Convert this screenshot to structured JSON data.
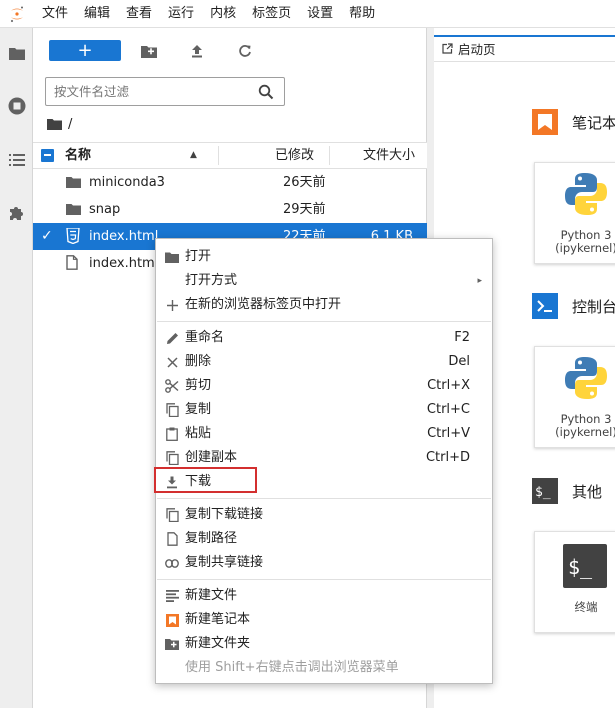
{
  "menubar": {
    "items": [
      "文件",
      "编辑",
      "查看",
      "运行",
      "内核",
      "标签页",
      "设置",
      "帮助"
    ]
  },
  "filebrowser": {
    "new_button": "+",
    "filter_placeholder": "按文件名过滤",
    "breadcrumb": "/",
    "columns": {
      "name": "名称",
      "modified": "已修改",
      "size": "文件大小"
    },
    "files": [
      {
        "name": "miniconda3",
        "modified": "26天前",
        "size": "",
        "icon": "folder-icon",
        "selected": false
      },
      {
        "name": "snap",
        "modified": "29天前",
        "size": "",
        "icon": "folder-icon",
        "selected": false
      },
      {
        "name": "index.html",
        "modified": "22天前",
        "size": "6.1 KB",
        "icon": "html5-icon",
        "selected": true
      },
      {
        "name": "index.html",
        "modified": "",
        "size": "",
        "icon": "file-icon",
        "selected": false
      }
    ]
  },
  "launcher": {
    "tab_label": "启动页",
    "sections": [
      {
        "title": "笔记本",
        "cards": [
          {
            "line1": "Python 3",
            "line2": "(ipykernel)"
          }
        ]
      },
      {
        "title": "控制台",
        "cards": [
          {
            "line1": "Python 3",
            "line2": "(ipykernel)"
          }
        ]
      },
      {
        "title": "其他",
        "cards": [
          {
            "line1": "终端",
            "line2": ""
          }
        ]
      }
    ]
  },
  "context_menu": {
    "items": [
      {
        "label": "打开",
        "shortcut": "",
        "icon": "folder-icon"
      },
      {
        "label": "打开方式",
        "shortcut": "",
        "icon": "",
        "submenu": true
      },
      {
        "label": "在新的浏览器标签页中打开",
        "shortcut": "",
        "icon": "plus-icon"
      },
      {
        "label": "重命名",
        "shortcut": "F2",
        "icon": "pencil-icon"
      },
      {
        "label": "删除",
        "shortcut": "Del",
        "icon": "close-icon"
      },
      {
        "label": "剪切",
        "shortcut": "Ctrl+X",
        "icon": "scissors-icon"
      },
      {
        "label": "复制",
        "shortcut": "Ctrl+C",
        "icon": "copy-icon"
      },
      {
        "label": "粘贴",
        "shortcut": "Ctrl+V",
        "icon": "paste-icon"
      },
      {
        "label": "创建副本",
        "shortcut": "Ctrl+D",
        "icon": "duplicate-icon"
      },
      {
        "label": "下载",
        "shortcut": "",
        "icon": "download-icon"
      },
      {
        "label": "复制下载链接",
        "shortcut": "",
        "icon": "copy-icon"
      },
      {
        "label": "复制路径",
        "shortcut": "",
        "icon": "file-icon"
      },
      {
        "label": "复制共享链接",
        "shortcut": "",
        "icon": "link-icon"
      },
      {
        "label": "新建文件",
        "shortcut": "",
        "icon": "text-file-icon"
      },
      {
        "label": "新建笔记本",
        "shortcut": "",
        "icon": "notebook-icon"
      },
      {
        "label": "新建文件夹",
        "shortcut": "",
        "icon": "new-folder-icon"
      },
      {
        "label": "使用 Shift+右键点击调出浏览器菜单",
        "shortcut": "",
        "icon": "",
        "disabled": true
      }
    ]
  },
  "colors": {
    "accent": "#1976d2",
    "highlight": "#d32f2f",
    "notebook_orange": "#f37726"
  }
}
